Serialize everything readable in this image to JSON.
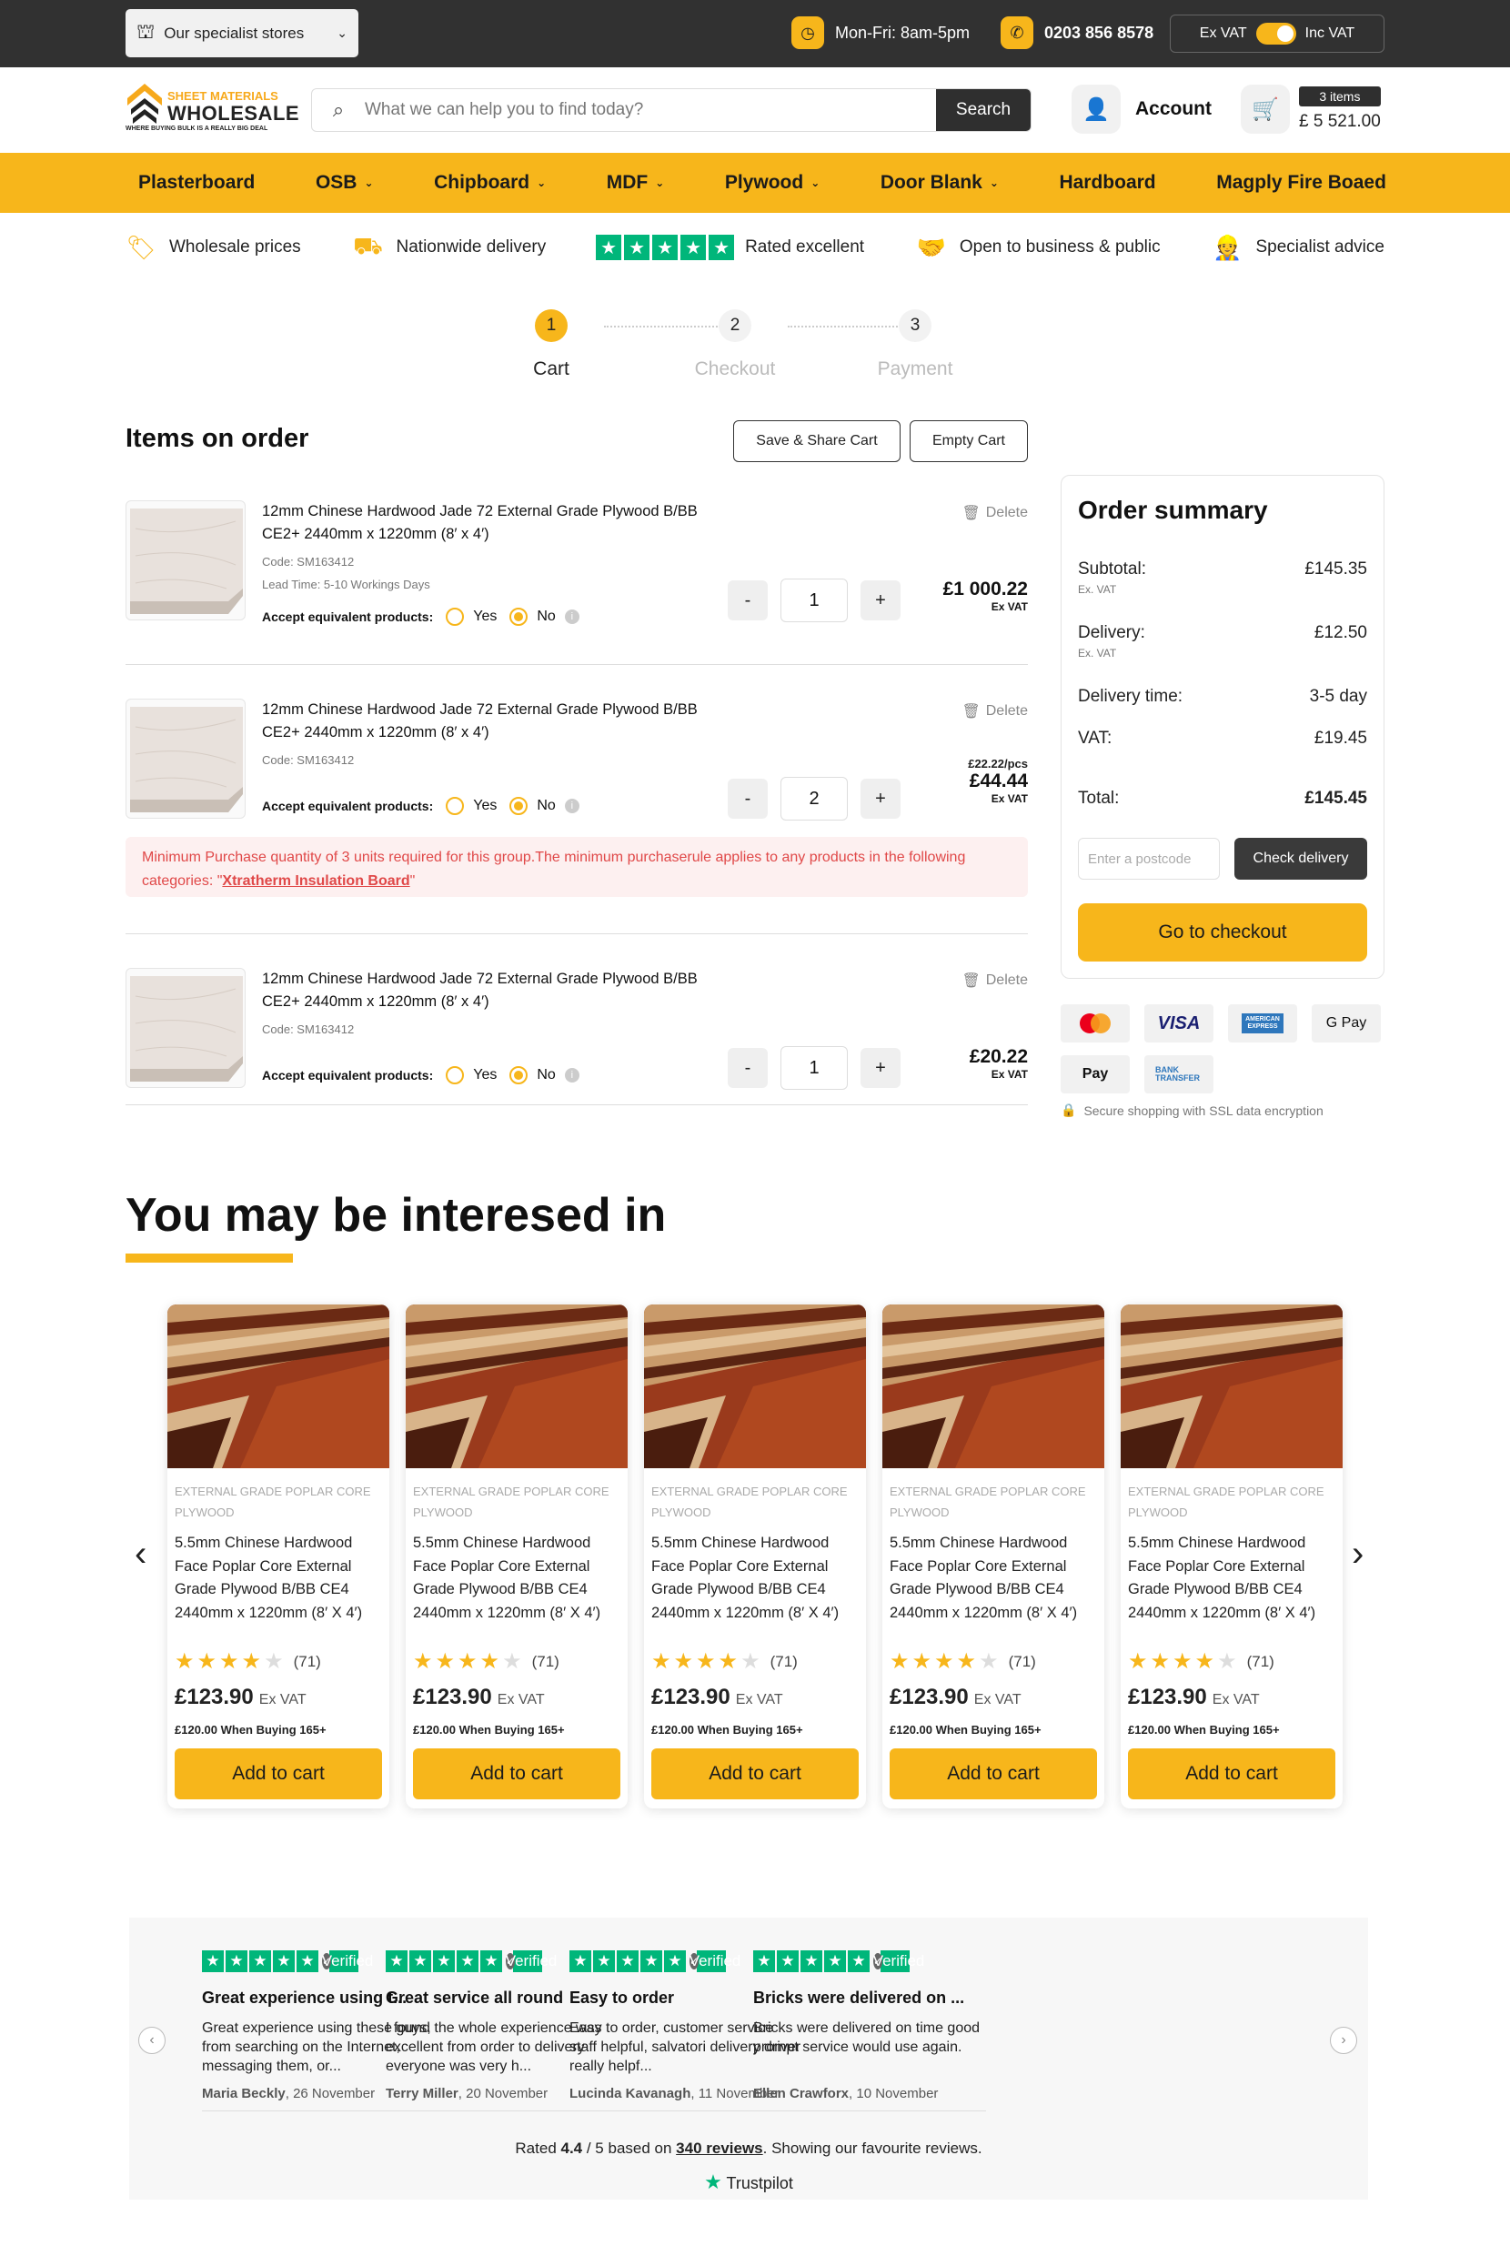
{
  "topbar": {
    "stores_label": "Our specialist stores",
    "hours": "Mon-Fri: 8am-5pm",
    "phone": "0203 856 8578",
    "ex_vat": "Ex VAT",
    "inc_vat": "Inc VAT"
  },
  "header": {
    "logo_line1": "SHEET MATERIALS",
    "logo_line2": "WHOLESALE",
    "logo_tagline": "WHERE BUYING BULK IS A REALLY BIG DEAL",
    "search_placeholder": "What we can help you to find today?",
    "search_button": "Search",
    "account_label": "Account",
    "cart_items": "3 items",
    "cart_total": "£ 5 521.00"
  },
  "nav": [
    {
      "label": "Plasterboard",
      "has_dropdown": false
    },
    {
      "label": "OSB",
      "has_dropdown": true
    },
    {
      "label": "Chipboard",
      "has_dropdown": true
    },
    {
      "label": "MDF",
      "has_dropdown": true
    },
    {
      "label": "Plywood",
      "has_dropdown": true
    },
    {
      "label": "Door Blank",
      "has_dropdown": true
    },
    {
      "label": "Hardboard",
      "has_dropdown": false
    },
    {
      "label": "Magply Fire Boaed",
      "has_dropdown": false
    }
  ],
  "perks": [
    {
      "label": "Wholesale prices",
      "icon": "tag-icon"
    },
    {
      "label": "Nationwide delivery",
      "icon": "truck-icon"
    },
    {
      "label": "Rated excellent",
      "icon": "trustpilot-stars-icon"
    },
    {
      "label": "Open to business & public",
      "icon": "handshake-icon"
    },
    {
      "label": "Specialist advice",
      "icon": "advisor-icon"
    }
  ],
  "steps": [
    {
      "num": "1",
      "label": "Cart",
      "active": true
    },
    {
      "num": "2",
      "label": "Checkout",
      "active": false
    },
    {
      "num": "3",
      "label": "Payment",
      "active": false
    }
  ],
  "items_section": {
    "title": "Items on order",
    "save_share": "Save & Share Cart",
    "empty_cart": "Empty Cart",
    "delete_label": "Delete",
    "accept_label": "Accept equivalent products:",
    "yes": "Yes",
    "no": "No"
  },
  "items": [
    {
      "name": "12mm Chinese Hardwood Jade 72 External Grade Plywood B/BB CE2+ 2440mm x 1220mm (8′ x 4′)",
      "code": "Code: SM163412",
      "lead_time": "Lead Time: 5-10 Workings Days",
      "qty": "1",
      "per_unit": "",
      "price": "£1 000.22",
      "price_note": "Ex VAT"
    },
    {
      "name": "12mm Chinese Hardwood Jade 72 External Grade Plywood B/BB CE2+ 2440mm x 1220mm (8′ x 4′)",
      "code": "Code: SM163412",
      "lead_time": "",
      "qty": "2",
      "per_unit": "£22.22/pcs",
      "price": "£44.44",
      "price_note": "Ex VAT"
    },
    {
      "name": "12mm Chinese Hardwood Jade 72 External Grade Plywood B/BB CE2+ 2440mm x 1220mm (8′ x 4′)",
      "code": "Code: SM163412",
      "lead_time": "",
      "qty": "1",
      "per_unit": "",
      "price": "£20.22",
      "price_note": "Ex VAT"
    }
  ],
  "warning": {
    "text": "Minimum Purchase quantity of 3 units required for this group.The minimum purchaserule applies to any products in the following categories: \"",
    "link": "Xtratherm Insulation Board",
    "tail": "\""
  },
  "summary": {
    "title": "Order summary",
    "subtotal_label": "Subtotal:",
    "subtotal_sub": "Ex. VAT",
    "subtotal": "£145.35",
    "delivery_label": "Delivery:",
    "delivery_sub": "Ex. VAT",
    "delivery": "£12.50",
    "delivery_time_label": "Delivery time:",
    "delivery_time": "3-5 day",
    "vat_label": "VAT:",
    "vat": "£19.45",
    "total_label": "Total:",
    "total": "£145.45",
    "postcode_placeholder": "Enter a postcode",
    "check_delivery": "Check delivery",
    "checkout": "Go to checkout",
    "ssl": "Secure shopping with SSL data encryption"
  },
  "payment_methods": [
    "mastercard",
    "VISA",
    "AMERICAN EXPRESS",
    "G Pay",
    "Pay",
    "BANK TRANSFER"
  ],
  "interested": {
    "title": "You may be interesed in",
    "cards": [
      {
        "category": "EXTERNAL GRADE POPLAR CORE PLYWOOD",
        "name": "5.5mm Chinese Hardwood Face Poplar Core External Grade Plywood B/BB CE4 2440mm x 1220mm (8′ X 4′)",
        "rating": 4,
        "reviews": "(71)",
        "price": "£123.90",
        "vat": "Ex VAT",
        "bulk": "£120.00 When Buying 165+",
        "button": "Add to cart"
      },
      {
        "category": "EXTERNAL GRADE POPLAR CORE PLYWOOD",
        "name": "5.5mm Chinese Hardwood Face Poplar Core External Grade Plywood B/BB CE4 2440mm x 1220mm (8′ X 4′)",
        "rating": 4,
        "reviews": "(71)",
        "price": "£123.90",
        "vat": "Ex VAT",
        "bulk": "£120.00 When Buying 165+",
        "button": "Add to cart"
      },
      {
        "category": "EXTERNAL GRADE POPLAR CORE PLYWOOD",
        "name": "5.5mm Chinese Hardwood Face Poplar Core External Grade Plywood B/BB CE4 2440mm x 1220mm (8′ X 4′)",
        "rating": 4,
        "reviews": "(71)",
        "price": "£123.90",
        "vat": "Ex VAT",
        "bulk": "£120.00 When Buying 165+",
        "button": "Add to cart"
      },
      {
        "category": "EXTERNAL GRADE POPLAR CORE PLYWOOD",
        "name": "5.5mm Chinese Hardwood Face Poplar Core External Grade Plywood B/BB CE4 2440mm x 1220mm (8′ X 4′)",
        "rating": 4,
        "reviews": "(71)",
        "price": "£123.90",
        "vat": "Ex VAT",
        "bulk": "£120.00 When Buying 165+",
        "button": "Add to cart"
      },
      {
        "category": "EXTERNAL GRADE POPLAR CORE PLYWOOD",
        "name": "5.5mm Chinese Hardwood Face Poplar Core External Grade Plywood B/BB CE4 2440mm x 1220mm (8′ X 4′)",
        "rating": 4,
        "reviews": "(71)",
        "price": "£123.90",
        "vat": "Ex VAT",
        "bulk": "£120.00 When Buying 165+",
        "button": "Add to cart"
      }
    ]
  },
  "reviews": {
    "verified": "Verified",
    "items": [
      {
        "title": "Great experience using t...",
        "body": "Great experience using these guys, from searching on the Internet, messaging them, or...",
        "author": "Maria Beckly",
        "date": ", 26 November"
      },
      {
        "title": "Great service all round",
        "body": "I found the whole experience was excellent from order to delivery everyone was very h...",
        "author": "Terry Miller",
        "date": ", 20 November"
      },
      {
        "title": "Easy to order",
        "body": "Easy to order, customer service staff helpful, salvatori delivery driver really helpf...",
        "author": "Lucinda Kavanagh",
        "date": ", 11 November"
      },
      {
        "title": "Bricks were delivered on ...",
        "body": "Bricks were delivered on time good prompt service would use again.",
        "author": "Ellen Crawforx",
        "date": ", 10 November"
      }
    ],
    "rated_prefix": "Rated ",
    "rating": "4.4",
    "rated_mid": " / 5 based on ",
    "count_link": "340 reviews",
    "rated_suffix": ". Showing our favourite reviews.",
    "brand": "Trustpilot"
  },
  "colors": {
    "accent": "#f7b61b",
    "dark": "#313131",
    "trustpilot": "#00b67a",
    "warning": "#e04848"
  }
}
